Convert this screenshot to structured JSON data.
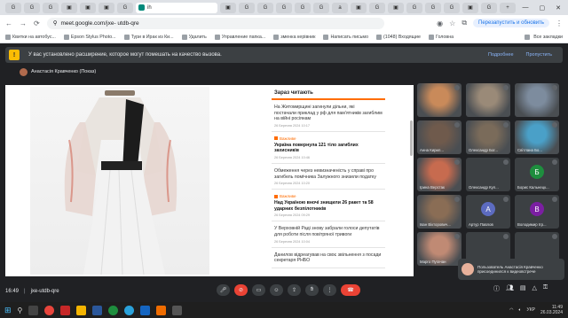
{
  "browser": {
    "tabs": [
      {
        "label": "G"
      },
      {
        "label": "G"
      },
      {
        "label": "G"
      },
      {
        "label": "▣"
      },
      {
        "label": "▣"
      },
      {
        "label": "▣"
      },
      {
        "label": "G"
      },
      {
        "label": "ih",
        "active": true
      },
      {
        "label": "▣"
      },
      {
        "label": "G"
      },
      {
        "label": "G"
      },
      {
        "label": "G"
      },
      {
        "label": "G"
      },
      {
        "label": "G"
      },
      {
        "label": "a"
      },
      {
        "label": "▣"
      },
      {
        "label": "G"
      },
      {
        "label": "▣"
      },
      {
        "label": "G"
      },
      {
        "label": "G"
      },
      {
        "label": "G"
      },
      {
        "label": "▣"
      },
      {
        "label": "G"
      },
      {
        "label": "+"
      }
    ],
    "url": "meet.google.com/jxe- utdb-qre",
    "update_button": "Перезапустить и обновить",
    "bookmarks": [
      "Квитки на автобус...",
      "Epson Stylus Photo...",
      "Тури в Ирак из Ки...",
      "Удалить",
      "Управление папка...",
      "зменка керівник",
      "Написать письмо",
      "(1048) Входящие",
      "Головна"
    ],
    "all_bookmarks": "Все закладки"
  },
  "extension_banner": {
    "icon": "!",
    "text": "У вас установлено расширение, которое могут помешать на качество вызова.",
    "actions": [
      "Подробнее",
      "Пропустить"
    ]
  },
  "presenter": "Анастасія Кравченко (Показ)",
  "article": {
    "heading": "Зараз читають",
    "items": [
      {
        "title": "На Житомирщині загинули дільни, які постачали приклад у рф для пам'ятників загиблим на війні росіянам",
        "date": "26 Березня 2024 10:17",
        "bold": false,
        "category": ""
      },
      {
        "title": "Україна повернула 121 тіло загиблих захисників",
        "date": "26 Березня 2024 10:46",
        "bold": true,
        "category": "Важливе"
      },
      {
        "title": "Обмеження через невизначеність у справі про загибель помічника Залужного знизили податку",
        "date": "26 Березня 2024 10:20",
        "bold": false,
        "category": ""
      },
      {
        "title": "Над Україною вночі знищили 26 ракет та 58 ударних безпілотників",
        "date": "26 Березня 2024 09:29",
        "bold": true,
        "category": "Важливе"
      },
      {
        "title": "У Верховній Раді знову забрали голоси депутатів для роботи після повітряної тривоги",
        "date": "26 Березня 2024 10:04",
        "bold": false,
        "category": ""
      },
      {
        "title": "Данилов відреагував на своє звільнення з посади секретаря РНБО",
        "date": "",
        "bold": false,
        "category": ""
      }
    ]
  },
  "participants": [
    {
      "name": "",
      "initial": "",
      "color": "#c98a5a",
      "photo": true
    },
    {
      "name": "",
      "initial": "",
      "color": "#9a8a78",
      "photo": true
    },
    {
      "name": "",
      "initial": "",
      "color": "#7d8c9e",
      "photo": true
    },
    {
      "name": "Анна Кирил...",
      "initial": "",
      "color": "#6f5a4c",
      "photo": true
    },
    {
      "name": "Олександр Бог...",
      "initial": "",
      "color": "#7a6b5a",
      "photo": true
    },
    {
      "name": "Світлана Бо...",
      "initial": "",
      "color": "#4aa0c8",
      "photo": true
    },
    {
      "name": "Ірина Верстак",
      "initial": "",
      "color": "#c76b4f",
      "photo": true
    },
    {
      "name": "Олександр Кул...",
      "initial": "",
      "color": "#5f6368",
      "photo": false
    },
    {
      "name": "Борис Кальнецк...",
      "initial": "Б",
      "color": "#1e8e3e",
      "photo": false
    },
    {
      "name": "Іван Вікторович...",
      "initial": "",
      "color": "#8a6d55",
      "photo": true
    },
    {
      "name": "Артур Павлов",
      "initial": "А",
      "color": "#5c6bc0",
      "photo": false
    },
    {
      "name": "Володимир Ігр...",
      "initial": "В",
      "color": "#7b1fa2",
      "photo": false
    },
    {
      "name": "Марго Пугачан",
      "initial": "",
      "color": "#c08a74",
      "photo": true
    },
    {
      "name": "",
      "initial": "",
      "color": "#3c4043",
      "photo": false
    },
    {
      "name": "",
      "initial": "",
      "color": "#3c4043",
      "photo": false
    }
  ],
  "toast": {
    "text": "Пользователь Анастасія Кравченко присоединился к видеовстрече"
  },
  "meeting": {
    "time": "16:49",
    "code": "jxe-utdb-qre"
  },
  "taskbar": {
    "lang": "УКР",
    "time": "11:49",
    "date": "26.03.2024"
  },
  "colors": {
    "accent": "#ff6c00",
    "end_call": "#ea4335",
    "meet_bg": "#202124"
  }
}
